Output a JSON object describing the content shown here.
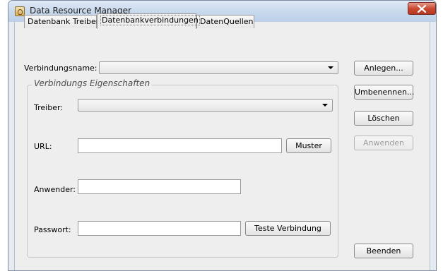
{
  "window": {
    "title": "Data Resource Manager"
  },
  "tabs": [
    {
      "label": "Datenbank Treiber"
    },
    {
      "label": "Datenbankverbindungen"
    },
    {
      "label": "DatenQuellen"
    }
  ],
  "form": {
    "connection_name_label": "Verbindungsname:",
    "group_title": "Verbindungs Eigenschaften",
    "driver_label": "Treiber:",
    "url_label": "URL:",
    "user_label": "Anwender:",
    "password_label": "Passwort:"
  },
  "buttons": {
    "create": "Anlegen...",
    "rename": "Umbenennen...",
    "delete": "Löschen",
    "apply": "Anwenden",
    "pattern": "Muster",
    "test_connection": "Teste Verbindung",
    "quit": "Beenden"
  },
  "icons": {
    "app": "app-icon",
    "close": "close-icon"
  },
  "colors": {
    "close_button": "#c94a33",
    "titlebar": "#c7d8ec"
  }
}
